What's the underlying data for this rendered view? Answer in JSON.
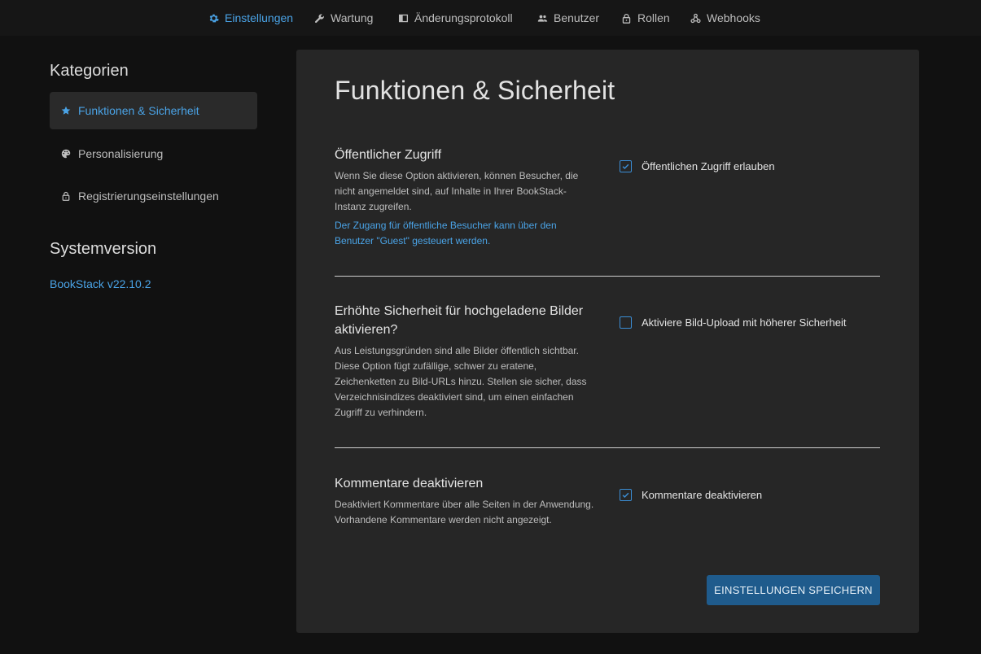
{
  "nav": {
    "items": [
      {
        "label": "Einstellungen",
        "icon": "gear-icon"
      },
      {
        "label": "Wartung",
        "icon": "wrench-icon"
      },
      {
        "label": "Änderungsprotokoll",
        "icon": "book-icon"
      },
      {
        "label": "Benutzer",
        "icon": "users-icon"
      },
      {
        "label": "Rollen",
        "icon": "lock-icon"
      },
      {
        "label": "Webhooks",
        "icon": "webhook-icon"
      }
    ],
    "active": "Einstellungen"
  },
  "sidebar": {
    "categories_heading": "Kategorien",
    "items": [
      {
        "label": "Funktionen & Sicherheit",
        "icon": "star-icon"
      },
      {
        "label": "Personalisierung",
        "icon": "palette-icon"
      },
      {
        "label": "Registrierungseinstellungen",
        "icon": "lock-icon"
      }
    ],
    "version_heading": "Systemversion",
    "version_link": "BookStack v22.10.2"
  },
  "main": {
    "title": "Funktionen & Sicherheit",
    "sections": [
      {
        "title": "Öffentlicher Zugriff",
        "description": "Wenn Sie diese Option aktivieren, können Besucher, die nicht angemeldet sind, auf Inhalte in Ihrer BookStack-Instanz zugreifen.",
        "note": "Der Zugang für öffentliche Besucher kann über den Benutzer \"Guest\" gesteuert werden.",
        "checkbox_label": "Öffentlichen Zugriff erlauben",
        "checked": true
      },
      {
        "title": "Erhöhte Sicherheit für hochgeladene Bilder aktivieren?",
        "description": "Aus Leistungsgründen sind alle Bilder öffentlich sichtbar. Diese Option fügt zufällige, schwer zu eratene, Zeichenketten zu Bild-URLs hinzu. Stellen sie sicher, dass Verzeichnisindizes deaktiviert sind, um einen einfachen Zugriff zu verhindern.",
        "checkbox_label": "Aktiviere Bild-Upload mit höherer Sicherheit",
        "checked": false
      },
      {
        "title": "Kommentare deaktivieren",
        "description": "Deaktiviert Kommentare über alle Seiten in der Anwendung. Vorhandene Kommentare werden nicht angezeigt.",
        "checkbox_label": "Kommentare deaktivieren",
        "checked": true
      }
    ],
    "save_label": "EINSTELLUNGEN SPEICHERN"
  },
  "colors": {
    "accent": "#4aa3e6",
    "button": "#1f5b8c",
    "background": "#111111",
    "card": "#262626"
  }
}
